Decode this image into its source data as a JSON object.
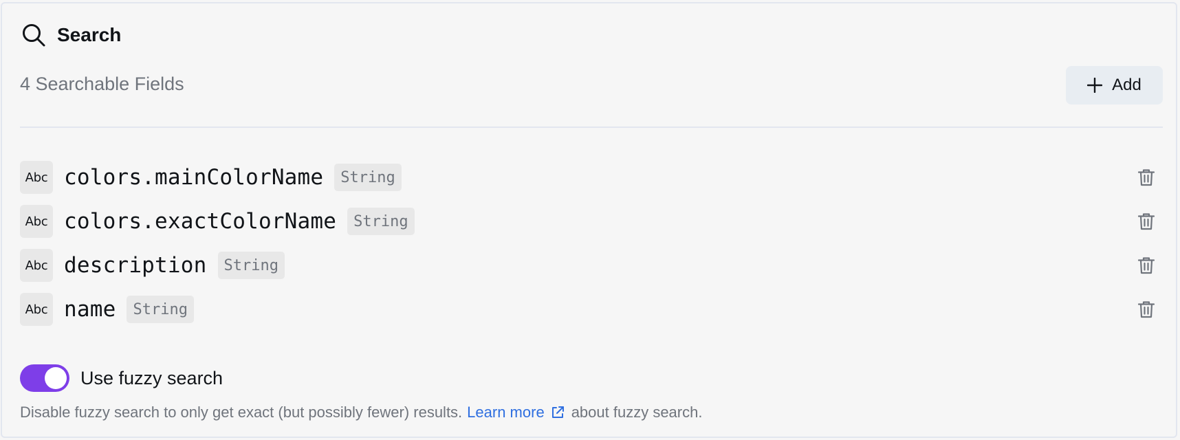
{
  "header": {
    "title": "Search",
    "icon": "search-icon"
  },
  "summary": {
    "count_label": "4 Searchable Fields",
    "add_label": "Add"
  },
  "fields": [
    {
      "name": "colors.mainColorName",
      "type": "String",
      "type_icon": "Abc"
    },
    {
      "name": "colors.exactColorName",
      "type": "String",
      "type_icon": "Abc"
    },
    {
      "name": "description",
      "type": "String",
      "type_icon": "Abc"
    },
    {
      "name": "name",
      "type": "String",
      "type_icon": "Abc"
    }
  ],
  "fuzzy": {
    "label": "Use fuzzy search",
    "enabled": true,
    "help_before": "Disable fuzzy search to only get exact (but possibly fewer) results.",
    "link_label": "Learn more",
    "help_after": "about fuzzy search."
  },
  "colors": {
    "accent": "#7e3ee8",
    "link": "#2f6fe0",
    "muted_text": "#6f747c",
    "text": "#111418"
  }
}
